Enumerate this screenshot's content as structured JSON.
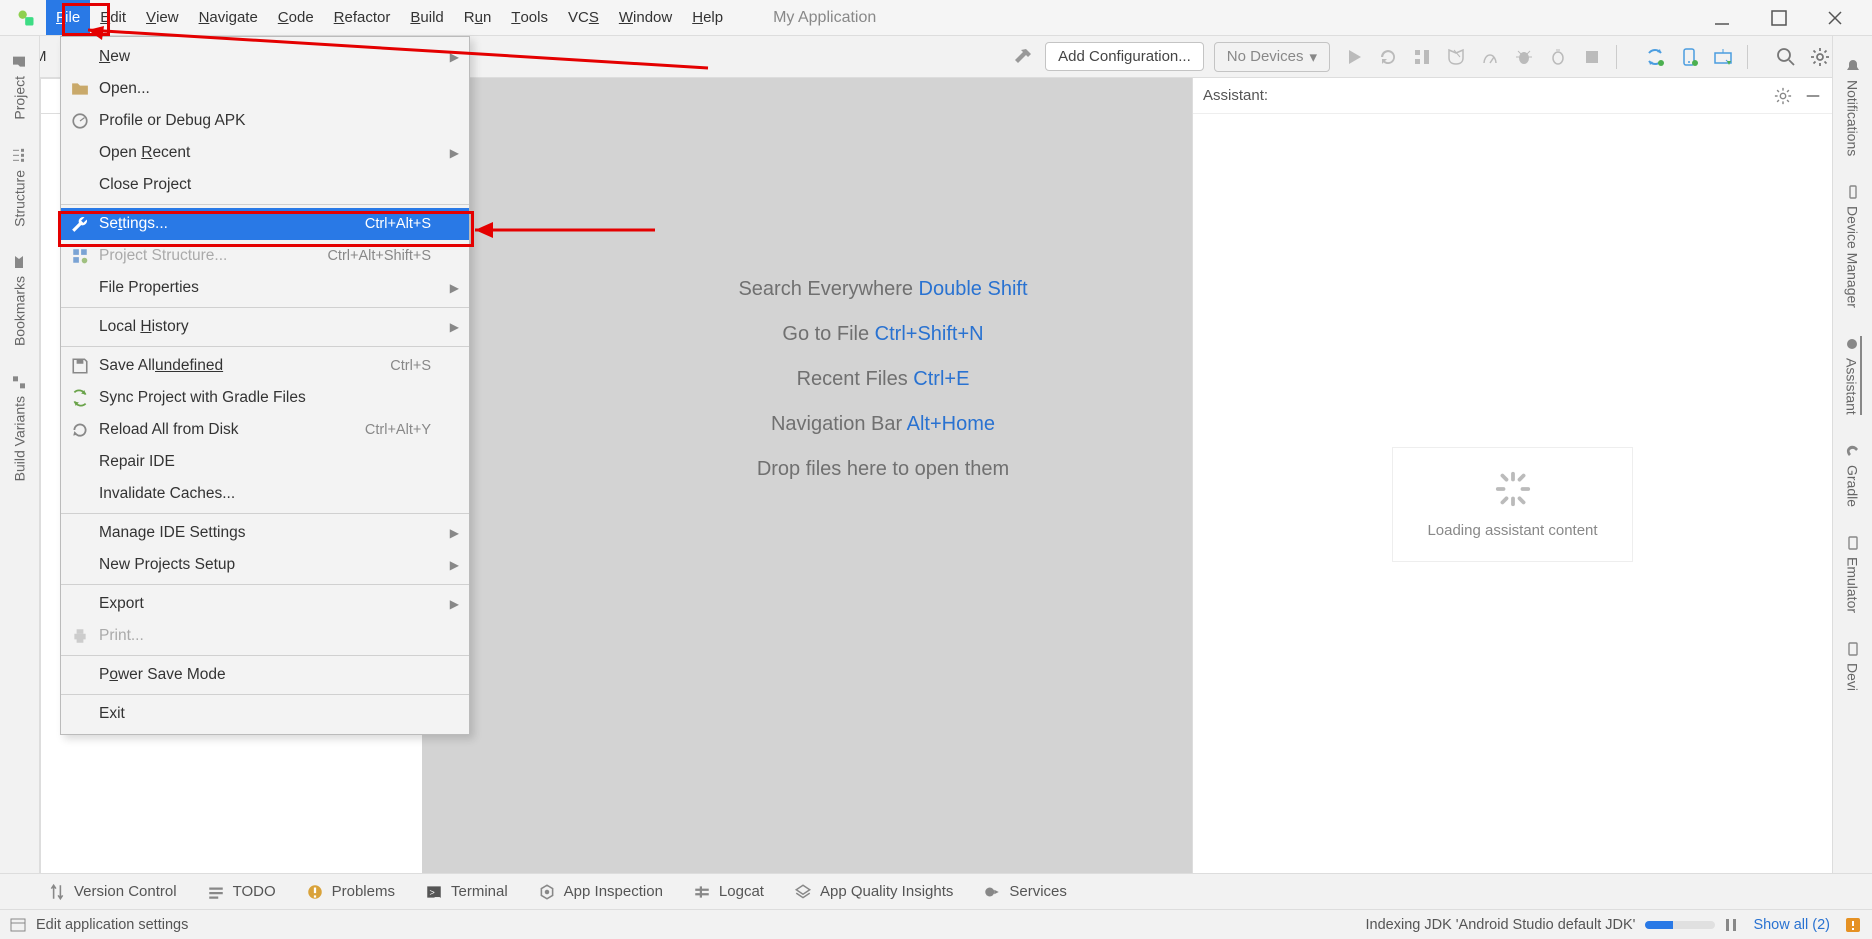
{
  "project_name": "My Application",
  "breadcrumb": "M",
  "menubar": [
    "File",
    "Edit",
    "View",
    "Navigate",
    "Code",
    "Refactor",
    "Build",
    "Run",
    "Tools",
    "VCS",
    "Window",
    "Help"
  ],
  "menubar_mnemonic": [
    0,
    0,
    0,
    0,
    0,
    0,
    0,
    1,
    0,
    2,
    0,
    0
  ],
  "toolbar": {
    "add_config": "Add Configuration...",
    "no_devices": "No Devices"
  },
  "file_menu": [
    {
      "label": "New",
      "short": "",
      "arrow": true,
      "icon": ""
    },
    {
      "label": "Open...",
      "short": "",
      "arrow": false,
      "icon": "folder"
    },
    {
      "label": "Profile or Debug APK",
      "short": "",
      "arrow": false,
      "icon": "profile"
    },
    {
      "label": "Open Recent",
      "short": "",
      "arrow": true,
      "icon": ""
    },
    {
      "label": "Close Project",
      "short": "",
      "arrow": false,
      "icon": ""
    },
    {
      "sep": true
    },
    {
      "label": "Settings...",
      "short": "Ctrl+Alt+S",
      "arrow": false,
      "icon": "wrench",
      "sel": true
    },
    {
      "label": "Project Structure...",
      "short": "Ctrl+Alt+Shift+S",
      "arrow": false,
      "icon": "pstruct",
      "disabled": true
    },
    {
      "label": "File Properties",
      "short": "",
      "arrow": true,
      "icon": ""
    },
    {
      "sep": true
    },
    {
      "label": "Local History",
      "short": "",
      "arrow": true,
      "icon": ""
    },
    {
      "sep": true
    },
    {
      "label": "Save All",
      "short": "Ctrl+S",
      "arrow": false,
      "icon": "save"
    },
    {
      "label": "Sync Project with Gradle Files",
      "short": "",
      "arrow": false,
      "icon": "sync"
    },
    {
      "label": "Reload All from Disk",
      "short": "Ctrl+Alt+Y",
      "arrow": false,
      "icon": "reload"
    },
    {
      "label": "Repair IDE",
      "short": "",
      "arrow": false,
      "icon": ""
    },
    {
      "label": "Invalidate Caches...",
      "short": "",
      "arrow": false,
      "icon": ""
    },
    {
      "sep": true
    },
    {
      "label": "Manage IDE Settings",
      "short": "",
      "arrow": true,
      "icon": ""
    },
    {
      "label": "New Projects Setup",
      "short": "",
      "arrow": true,
      "icon": ""
    },
    {
      "sep": true
    },
    {
      "label": "Export",
      "short": "",
      "arrow": true,
      "icon": ""
    },
    {
      "label": "Print...",
      "short": "",
      "arrow": false,
      "icon": "print",
      "disabled": true
    },
    {
      "sep": true
    },
    {
      "label": "Power Save Mode",
      "short": "",
      "arrow": false,
      "icon": ""
    },
    {
      "sep": true
    },
    {
      "label": "Exit",
      "short": "",
      "arrow": false,
      "icon": ""
    }
  ],
  "file_menu_mnemonic": {
    "0": 0,
    "3": 5,
    "6": 2,
    "10": 6,
    "11": 0,
    "12": 18,
    "24": 1
  },
  "hints": [
    {
      "t": "Search Everywhere ",
      "k": "Double Shift"
    },
    {
      "t": "Go to File ",
      "k": "Ctrl+Shift+N"
    },
    {
      "t": "Recent Files ",
      "k": "Ctrl+E"
    },
    {
      "t": "Navigation Bar ",
      "k": "Alt+Home"
    },
    {
      "t": "Drop files here to open them",
      "k": ""
    }
  ],
  "left_rail": [
    "Project",
    "Structure",
    "Bookmarks",
    "Build Variants"
  ],
  "right_rail": [
    "Notifications",
    "Device Manager",
    "Assistant",
    "Gradle",
    "Emulator",
    "Devi"
  ],
  "assistant": {
    "title": "Assistant:",
    "loading": "Loading assistant content"
  },
  "bottom_tools": [
    "Version Control",
    "TODO",
    "Problems",
    "Terminal",
    "App Inspection",
    "Logcat",
    "App Quality Insights",
    "Services"
  ],
  "status": {
    "left": "Edit application settings",
    "indexing": "Indexing JDK 'Android Studio default JDK'",
    "show_all": "Show all (2)"
  }
}
